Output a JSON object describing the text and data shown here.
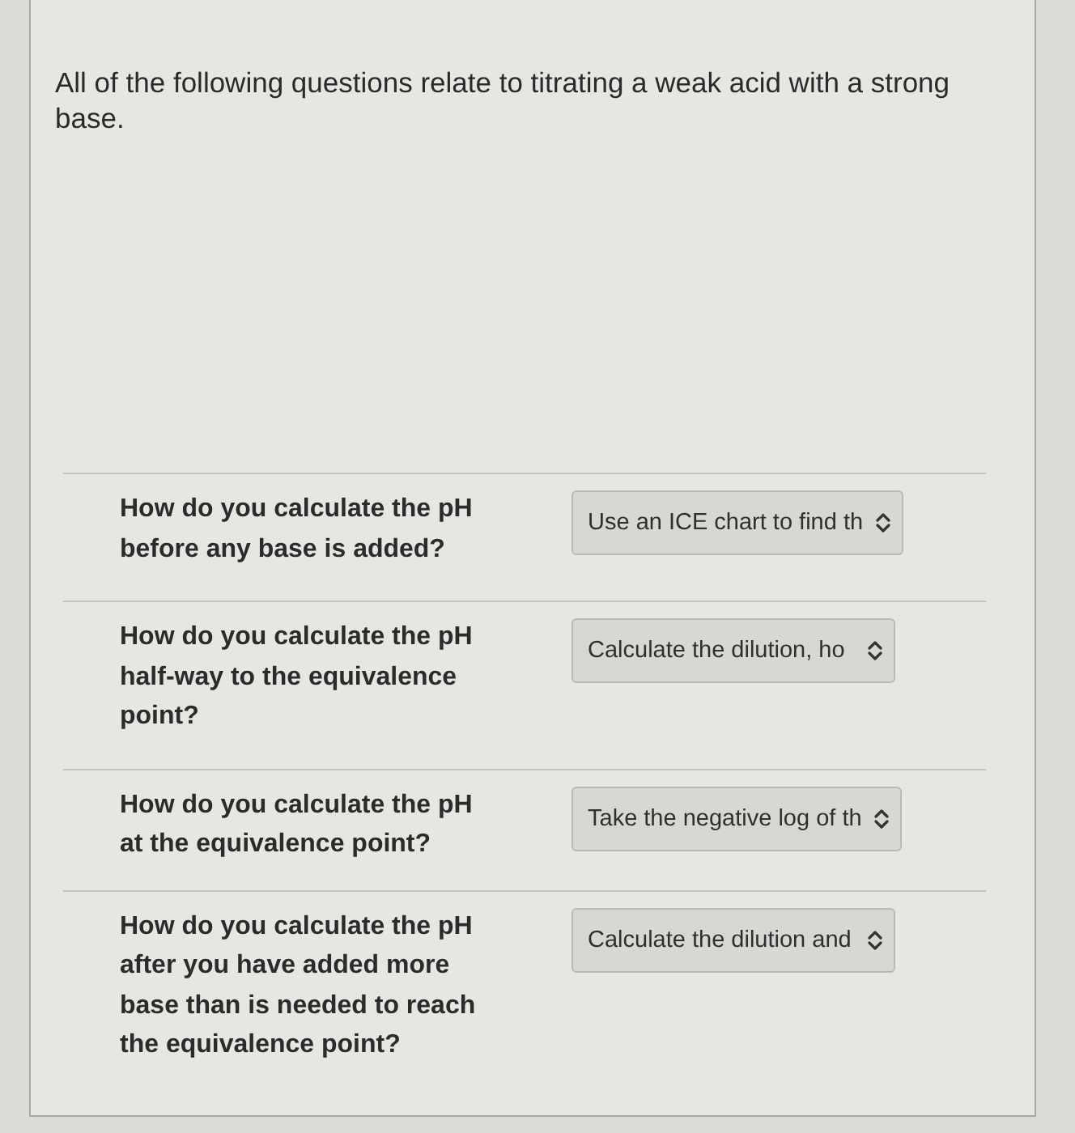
{
  "intro": "All of the following questions relate to titrating a weak acid with a strong base.",
  "questions": [
    {
      "prompt": "How do you calculate the pH before any base is added?",
      "answer": "Use an ICE chart to find th"
    },
    {
      "prompt": "How do you calculate the pH half-way to the equivalence point?",
      "answer": "Calculate the dilution, ho"
    },
    {
      "prompt": "How do you calculate the pH at the equivalence point?",
      "answer": "Take the negative log of th"
    },
    {
      "prompt": "How do you calculate the pH after you have added more base than is needed to reach the equivalence point?",
      "answer": "Calculate the dilution and"
    }
  ]
}
